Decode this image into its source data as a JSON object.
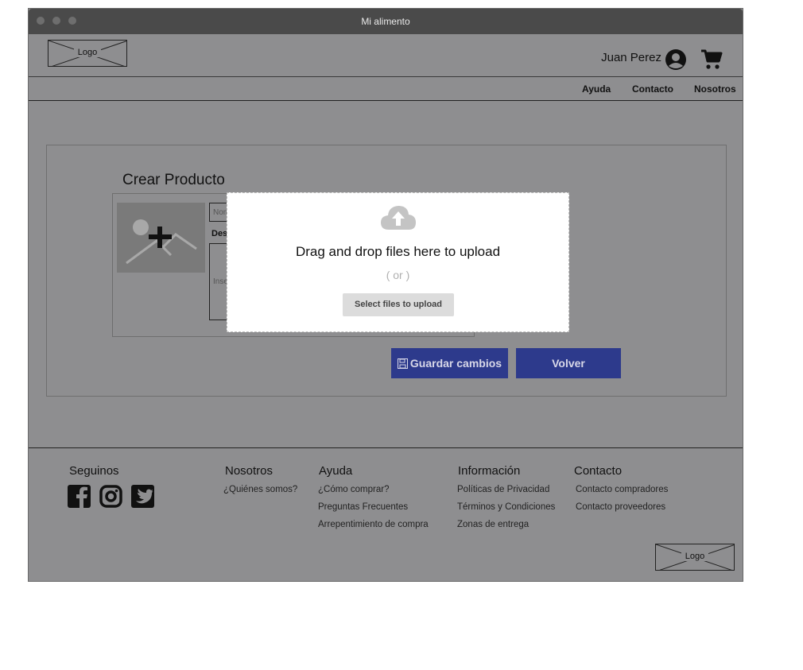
{
  "window": {
    "title": "Mi alimento"
  },
  "header": {
    "logo_text": "Logo",
    "user_name": "Juan Perez",
    "icons": {
      "user": "user-circle-icon",
      "cart": "cart-icon"
    }
  },
  "nav": {
    "items": [
      "Ayuda",
      "Contacto",
      "Nosotros"
    ]
  },
  "main": {
    "title": "Crear Producto",
    "form": {
      "name_placeholder": "Nombre",
      "desc_label": "Descripción",
      "desc_placeholder": "Inserte descripción"
    },
    "upload": {
      "title": "Drag and drop files here to upload",
      "or": "( or )",
      "select_label": "Select files to upload",
      "icon": "cloud-upload-icon"
    },
    "buttons": {
      "save": "Guardar cambios",
      "back": "Volver"
    }
  },
  "footer": {
    "seguinos": "Seguinos",
    "social_icons": [
      "facebook-icon",
      "instagram-icon",
      "twitter-icon"
    ],
    "columns": [
      {
        "title": "Nosotros",
        "links": [
          "¿Quiénes somos?"
        ]
      },
      {
        "title": "Ayuda",
        "links": [
          "¿Cómo comprar?",
          "Preguntas Frecuentes",
          "Arrepentimiento de compra"
        ]
      },
      {
        "title": "Información",
        "links": [
          "Políticas de Privacidad",
          "Términos y Condiciones",
          "Zonas de entrega"
        ]
      },
      {
        "title": "Contacto",
        "links": [
          "Contacto compradores",
          "Contacto proveedores"
        ]
      }
    ],
    "logo_text": "Logo"
  },
  "colors": {
    "primary_button": "#2d3a8c",
    "window_bg": "#8e8e90",
    "titlebar": "#4a4a4a"
  }
}
